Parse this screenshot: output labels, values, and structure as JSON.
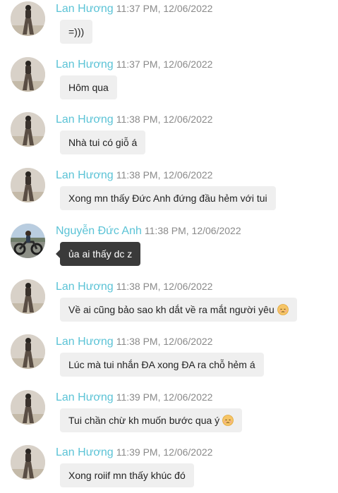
{
  "messages": [
    {
      "sender": "Lan Hương",
      "time": "11:37 PM, 12/06/2022",
      "text": "=)))",
      "avatar": "lan-huong-avatar",
      "style": "light",
      "emoji": ""
    },
    {
      "sender": "Lan Hương",
      "time": "11:37 PM, 12/06/2022",
      "text": "Hôm qua",
      "avatar": "lan-huong-avatar",
      "style": "light",
      "emoji": ""
    },
    {
      "sender": "Lan Hương",
      "time": "11:38 PM, 12/06/2022",
      "text": "Nhà tui có giỗ á",
      "avatar": "lan-huong-avatar",
      "style": "light",
      "emoji": ""
    },
    {
      "sender": "Lan Hương",
      "time": "11:38 PM, 12/06/2022",
      "text": "Xong mn thấy Đức Anh đứng đầu hẻm với tui",
      "avatar": "lan-huong-avatar",
      "style": "light",
      "emoji": ""
    },
    {
      "sender": "Nguyễn Đức Anh",
      "time": "11:38 PM, 12/06/2022",
      "text": "ủa ai thấy dc z",
      "avatar": "duc-anh-avatar",
      "style": "dark",
      "emoji": ""
    },
    {
      "sender": "Lan Hương",
      "time": "11:38 PM, 12/06/2022",
      "text": "Về ai cũng bảo sao kh dắt về ra mắt người yêu",
      "avatar": "lan-huong-avatar",
      "style": "light",
      "emoji": "pensive-face-emoji"
    },
    {
      "sender": "Lan Hương",
      "time": "11:38 PM, 12/06/2022",
      "text": "Lúc mà tui nhắn ĐA xong ĐA ra chỗ hẻm á",
      "avatar": "lan-huong-avatar",
      "style": "light",
      "emoji": ""
    },
    {
      "sender": "Lan Hương",
      "time": "11:39 PM, 12/06/2022",
      "text": "Tui chần chừ kh muốn bước qua ý",
      "avatar": "lan-huong-avatar",
      "style": "light",
      "emoji": "pensive-face-emoji"
    },
    {
      "sender": "Lan Hương",
      "time": "11:39 PM, 12/06/2022",
      "text": "Xong roiif mn thấy khúc đó",
      "avatar": "lan-huong-avatar",
      "style": "light",
      "emoji": ""
    }
  ],
  "colors": {
    "sender_name": "#5bc3d6",
    "timestamp": "#8a8a8a",
    "bubble_light": "#efefef",
    "bubble_dark": "#3a3a3a"
  }
}
